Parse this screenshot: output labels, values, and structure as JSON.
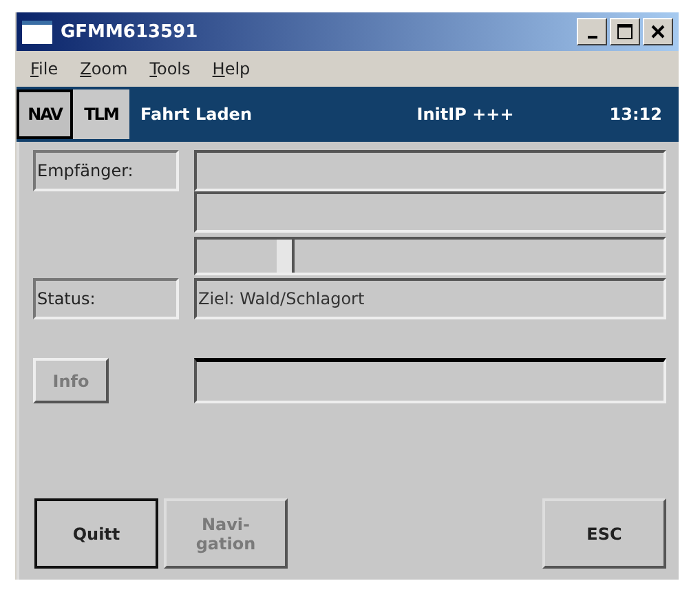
{
  "window": {
    "title": "GFMM613591"
  },
  "menu": [
    "File",
    "Zoom",
    "Tools",
    "Help"
  ],
  "mode_tabs": [
    {
      "label": "NAV",
      "selected": true
    },
    {
      "label": "TLM",
      "selected": false
    }
  ],
  "status_bar": {
    "job": "Fahrt Laden",
    "state": "InitIP +++",
    "time": "13:12"
  },
  "recipient": {
    "label": "Empfänger:"
  },
  "slider": {
    "level": 0.19
  },
  "status": {
    "label": "Status:",
    "value": "Ziel: Wald/Schlagort"
  },
  "info": {
    "label": "Info",
    "disabled": true
  },
  "buttons": [
    {
      "label": "Quitt",
      "disabled": false,
      "default": true
    },
    {
      "label": "Navi-gation",
      "disabled": true,
      "default": false
    },
    {
      "label": "ESC",
      "disabled": false,
      "default": false
    }
  ]
}
